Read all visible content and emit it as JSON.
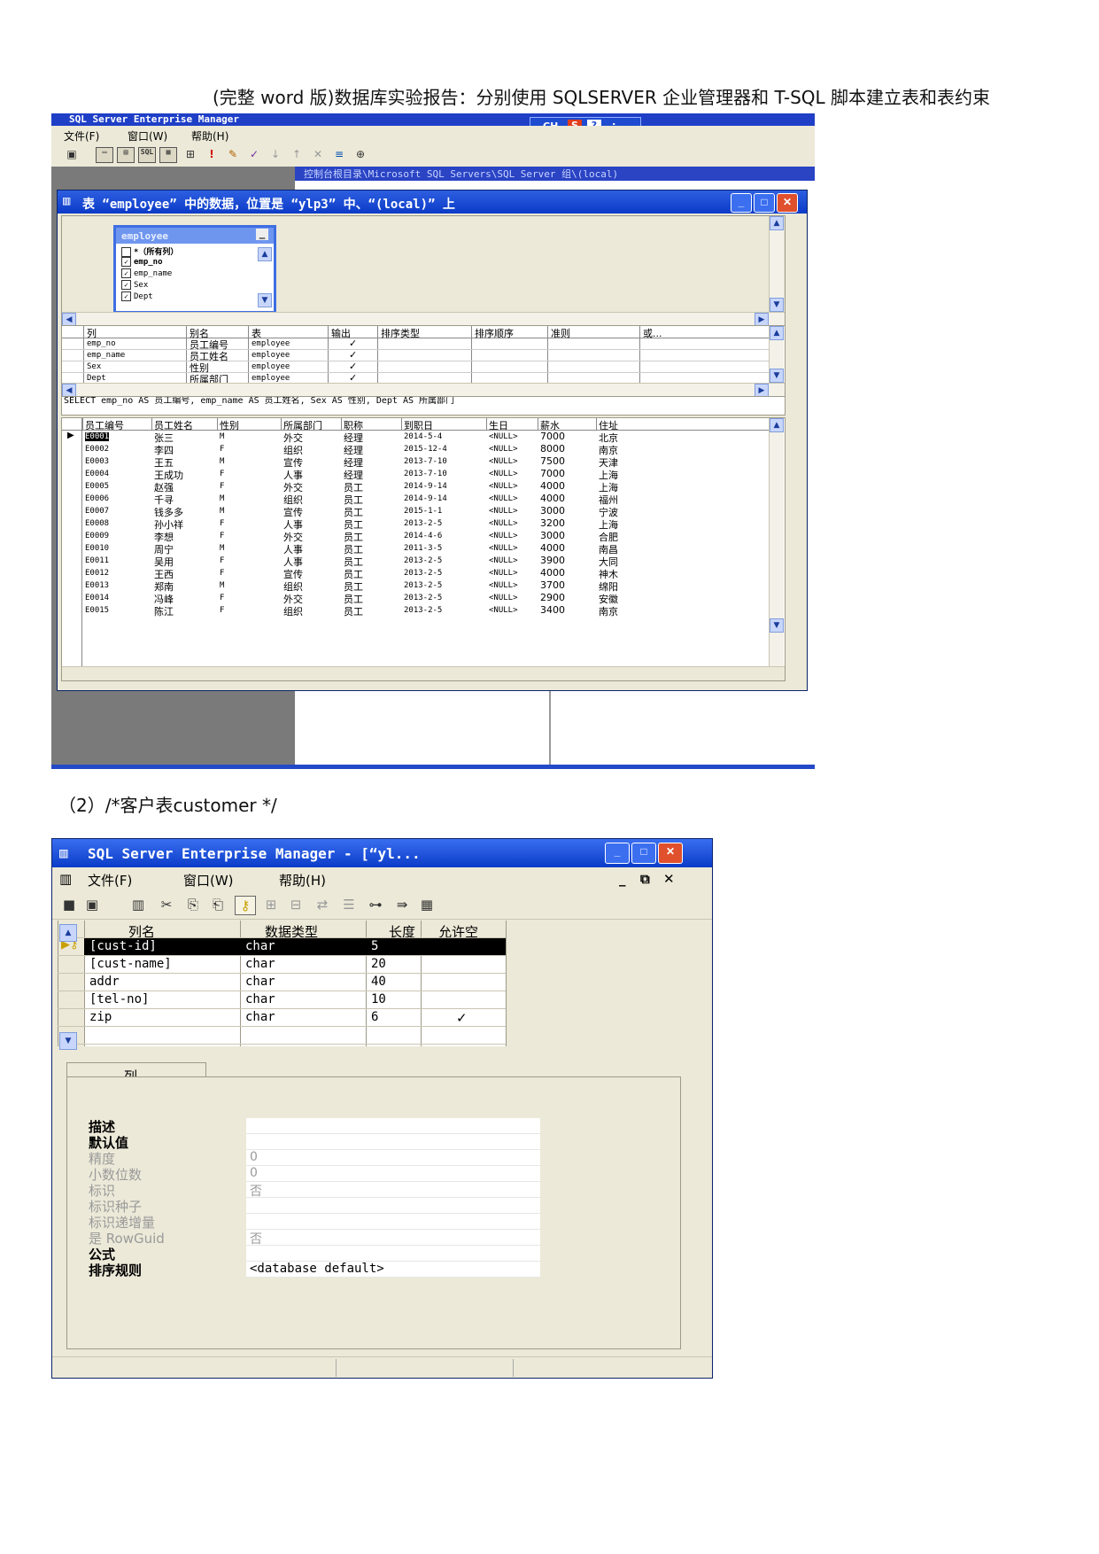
{
  "doc": {
    "title": "(完整 word 版)数据库实验报告：分别使用 SQLSERVER 企业管理器和 T-SQL 脚本建立表和表约束",
    "section_label": "（2）/*客户表customer */"
  },
  "shot1": {
    "app_title": "SQL Server Enterprise Manager",
    "ime_label": "CH",
    "menu": [
      "文件(F)",
      "窗口(W)",
      "帮助(H)"
    ],
    "bg_window_title": "控制台根目录\\Microsoft SQL Servers\\SQL Server 组\\(local)",
    "window_title": "表 “employee” 中的数据，位置是 “ylp3” 中、“(local)” 上",
    "table_box": {
      "name": "employee",
      "columns": [
        "*（所有列）",
        "emp_no",
        "emp_name",
        "Sex",
        "Dept"
      ]
    },
    "criteria_headers": [
      "列",
      "别名",
      "表",
      "输出",
      "排序类型",
      "排序顺序",
      "准则",
      "或..."
    ],
    "criteria_rows": [
      {
        "col": "emp_no",
        "alias": "员工编号",
        "table": "employee",
        "out": "✓"
      },
      {
        "col": "emp_name",
        "alias": "员工姓名",
        "table": "employee",
        "out": "✓"
      },
      {
        "col": "Sex",
        "alias": "性别",
        "table": "employee",
        "out": "✓"
      },
      {
        "col": "Dept",
        "alias": "所属部门",
        "table": "employee",
        "out": "✓"
      }
    ],
    "sql_text": "SELECT emp_no AS 员工编号, emp_name AS 员工姓名, Sex AS 性别, Dept AS 所属部门",
    "result_headers": [
      "员工编号",
      "员工姓名",
      "性别",
      "所属部门",
      "职称",
      "到职日",
      "生日",
      "薪水",
      "住址"
    ],
    "result_rows": [
      [
        "E0001",
        "张三",
        "M",
        "外交",
        "经理",
        "2014-5-4",
        "<NULL>",
        "7000",
        "北京"
      ],
      [
        "E0002",
        "李四",
        "F",
        "组织",
        "经理",
        "2015-12-4",
        "<NULL>",
        "8000",
        "南京"
      ],
      [
        "E0003",
        "王五",
        "M",
        "宣传",
        "经理",
        "2013-7-10",
        "<NULL>",
        "7500",
        "天津"
      ],
      [
        "E0004",
        "王成功",
        "F",
        "人事",
        "经理",
        "2013-7-10",
        "<NULL>",
        "7000",
        "上海"
      ],
      [
        "E0005",
        "赵强",
        "F",
        "外交",
        "员工",
        "2014-9-14",
        "<NULL>",
        "4000",
        "上海"
      ],
      [
        "E0006",
        "千寻",
        "M",
        "组织",
        "员工",
        "2014-9-14",
        "<NULL>",
        "4000",
        "福州"
      ],
      [
        "E0007",
        "钱多多",
        "M",
        "宣传",
        "员工",
        "2015-1-1",
        "<NULL>",
        "3000",
        "宁波"
      ],
      [
        "E0008",
        "孙小祥",
        "F",
        "人事",
        "员工",
        "2013-2-5",
        "<NULL>",
        "3200",
        "上海"
      ],
      [
        "E0009",
        "李想",
        "F",
        "外交",
        "员工",
        "2014-4-6",
        "<NULL>",
        "3000",
        "合肥"
      ],
      [
        "E0010",
        "周宁",
        "M",
        "人事",
        "员工",
        "2011-3-5",
        "<NULL>",
        "4000",
        "南昌"
      ],
      [
        "E0011",
        "吴用",
        "F",
        "人事",
        "员工",
        "2013-2-5",
        "<NULL>",
        "3900",
        "大同"
      ],
      [
        "E0012",
        "王西",
        "F",
        "宣传",
        "员工",
        "2013-2-5",
        "<NULL>",
        "4000",
        "神木"
      ],
      [
        "E0013",
        "郑南",
        "M",
        "组织",
        "员工",
        "2013-2-5",
        "<NULL>",
        "3700",
        "绵阳"
      ],
      [
        "E0014",
        "冯峰",
        "F",
        "外交",
        "员工",
        "2013-2-5",
        "<NULL>",
        "2900",
        "安徽"
      ],
      [
        "E0015",
        "陈江",
        "F",
        "组织",
        "员工",
        "2013-2-5",
        "<NULL>",
        "3400",
        "南京"
      ]
    ]
  },
  "shot2": {
    "window_title": "SQL Server Enterprise Manager - [“yl...",
    "menu": [
      "文件(F)",
      "窗口(W)",
      "帮助(H)"
    ],
    "grid_headers": [
      "列名",
      "数据类型",
      "长度",
      "允许空"
    ],
    "grid_rows": [
      {
        "name": "[cust-id]",
        "type": "char",
        "len": "5",
        "null": ""
      },
      {
        "name": "[cust-name]",
        "type": "char",
        "len": "20",
        "null": ""
      },
      {
        "name": "addr",
        "type": "char",
        "len": "40",
        "null": ""
      },
      {
        "name": "[tel-no]",
        "type": "char",
        "len": "10",
        "null": ""
      },
      {
        "name": "zip",
        "type": "char",
        "len": "6",
        "null": "✓"
      }
    ],
    "tab_label": "列",
    "properties": [
      {
        "label": "描述",
        "value": "",
        "dim": false
      },
      {
        "label": "默认值",
        "value": "",
        "dim": false
      },
      {
        "label": "精度",
        "value": "0",
        "dim": true
      },
      {
        "label": "小数位数",
        "value": "0",
        "dim": true
      },
      {
        "label": "标识",
        "value": "否",
        "dim": true
      },
      {
        "label": "标识种子",
        "value": "",
        "dim": true
      },
      {
        "label": "标识递增量",
        "value": "",
        "dim": true
      },
      {
        "label": "是 RowGuid",
        "value": "否",
        "dim": true
      },
      {
        "label": "公式",
        "value": "",
        "dim": false
      },
      {
        "label": "排序规则",
        "value": "<database default>",
        "dim": false
      }
    ]
  }
}
